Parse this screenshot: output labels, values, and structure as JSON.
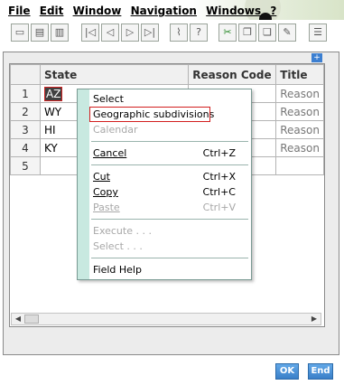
{
  "menubar": {
    "items": [
      "File",
      "Edit",
      "Window",
      "Navigation",
      "Windows",
      "?"
    ]
  },
  "toolbar": {
    "icons": [
      "save-icon",
      "print-icon",
      "print-preview-icon",
      "first-record-icon",
      "previous-record-icon",
      "next-record-icon",
      "last-record-icon",
      "attach-icon",
      "help-icon",
      "tools-icon",
      "copy-window-icon",
      "duplicate-icon",
      "edit-icon",
      "list-icon"
    ]
  },
  "grid": {
    "columns": [
      "State",
      "Reason Code",
      "Title"
    ],
    "rows": [
      {
        "num": "1",
        "state": "AZ",
        "reason": "",
        "title": "Reason"
      },
      {
        "num": "2",
        "state": "WY",
        "reason": "",
        "title": "Reason"
      },
      {
        "num": "3",
        "state": "HI",
        "reason": "",
        "title": "Reason"
      },
      {
        "num": "4",
        "state": "KY",
        "reason": "",
        "title": "Reason"
      },
      {
        "num": "5",
        "state": "",
        "reason": "",
        "title": ""
      }
    ]
  },
  "context_menu": {
    "select": "Select",
    "geographic": "Geographic subdivisions",
    "calendar": "Calendar",
    "cancel": "Cancel",
    "cancel_sc": "Ctrl+Z",
    "cut": "Cut",
    "cut_sc": "Ctrl+X",
    "copy": "Copy",
    "copy_sc": "Ctrl+C",
    "paste": "Paste",
    "paste_sc": "Ctrl+V",
    "execute": "Execute . . .",
    "select_more": "Select . . .",
    "field_help": "Field Help"
  },
  "buttons": {
    "ok": "OK",
    "end": "End"
  }
}
